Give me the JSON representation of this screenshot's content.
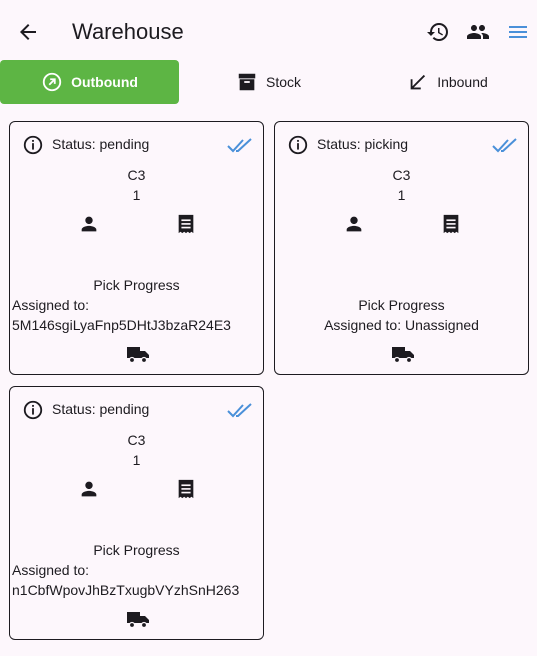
{
  "app": {
    "title": "Warehouse",
    "icons": {
      "back": "arrow-back-icon",
      "history": "history-icon",
      "people": "people-icon",
      "menu": "menu-icon"
    },
    "accent_color": "#5db544",
    "check_color": "#4a90d9"
  },
  "tabs": [
    {
      "label": "Outbound",
      "icon": "outbound-arrow-icon",
      "active": true
    },
    {
      "label": "Stock",
      "icon": "archive-box-icon",
      "active": false
    },
    {
      "label": "Inbound",
      "icon": "inbound-arrow-icon",
      "active": false
    }
  ],
  "orders": [
    {
      "status": "Status: pending",
      "location": "C3",
      "quantity": "1",
      "progress_label": "Pick Progress",
      "assigned_label": "Assigned to:",
      "assignee": "5M146sgiLyaFnp5DHtJ3bzaR24E3"
    },
    {
      "status": "Status: picking",
      "location": "C3",
      "quantity": "1",
      "progress_label": "Pick Progress",
      "assigned_text": "Assigned to: Unassigned"
    },
    {
      "status": "Status: pending",
      "location": "C3",
      "quantity": "1",
      "progress_label": "Pick Progress",
      "assigned_label": "Assigned to:",
      "assignee": "n1CbfWpovJhBzTxugbVYzhSnH263"
    }
  ]
}
